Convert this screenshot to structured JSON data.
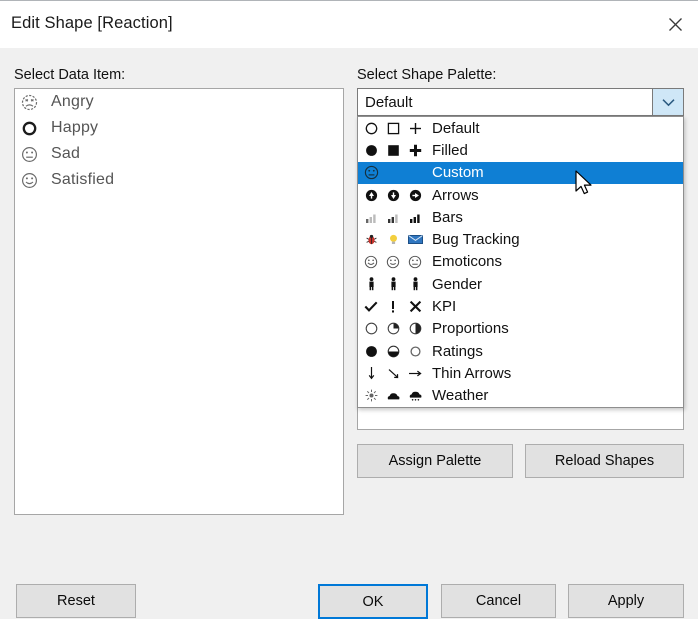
{
  "window": {
    "title": "Edit Shape [Reaction]",
    "close_icon": "close-icon"
  },
  "left_panel": {
    "label": "Select Data Item:",
    "items": [
      {
        "label": "Angry",
        "icon": "angry-face-icon"
      },
      {
        "label": "Happy",
        "icon": "open-circle-icon"
      },
      {
        "label": "Sad",
        "icon": "neutral-face-icon"
      },
      {
        "label": "Satisfied",
        "icon": "smiley-face-icon"
      }
    ]
  },
  "right_panel": {
    "label": "Select Shape Palette:",
    "combo": {
      "value": "Default",
      "arrow_icon": "chevron-down-icon"
    },
    "dropdown_options": [
      {
        "label": "Default",
        "icons": [
          "circle-outline-icon",
          "square-outline-icon",
          "plus-outline-icon"
        ]
      },
      {
        "label": "Filled",
        "icons": [
          "circle-filled-icon",
          "square-filled-icon",
          "plus-filled-icon"
        ]
      },
      {
        "label": "Custom",
        "icons": [
          "neutral-face-icon"
        ],
        "selected": true
      },
      {
        "label": "Arrows",
        "icons": [
          "arrow-up-circle-icon",
          "arrow-down-circle-icon",
          "arrow-right-circle-icon"
        ]
      },
      {
        "label": "Bars",
        "icons": [
          "bars-low-icon",
          "bars-mid-icon",
          "bars-high-icon"
        ]
      },
      {
        "label": "Bug Tracking",
        "icons": [
          "bug-icon",
          "lightbulb-icon",
          "envelope-icon"
        ]
      },
      {
        "label": "Emoticons",
        "icons": [
          "smiley-face-icon",
          "smiley-face-icon",
          "neutral-face-icon"
        ]
      },
      {
        "label": "Gender",
        "icons": [
          "person-icon",
          "person-icon",
          "person-icon"
        ]
      },
      {
        "label": "KPI",
        "icons": [
          "check-icon",
          "exclamation-icon",
          "cross-icon"
        ]
      },
      {
        "label": "Proportions",
        "icons": [
          "circle-empty-icon",
          "circle-quarter-icon",
          "circle-half-icon"
        ]
      },
      {
        "label": "Ratings",
        "icons": [
          "circle-full-icon",
          "circle-half-bottom-icon",
          "circle-hollow-icon"
        ]
      },
      {
        "label": "Thin Arrows",
        "icons": [
          "arrow-down-thin-icon",
          "arrow-diag-thin-icon",
          "arrow-right-thin-icon"
        ]
      },
      {
        "label": "Weather",
        "icons": [
          "sun-icon",
          "cloud-icon",
          "rain-cloud-icon"
        ]
      }
    ],
    "assign_palette_label": "Assign Palette",
    "reload_shapes_label": "Reload Shapes"
  },
  "footer": {
    "reset_label": "Reset",
    "ok_label": "OK",
    "cancel_label": "Cancel",
    "apply_label": "Apply"
  },
  "colors": {
    "selection_blue": "#0f7fd4",
    "focus_blue": "#0078d7",
    "dialog_bg": "#f0f0f0",
    "combo_arrow_bg": "#cfe7f7"
  }
}
